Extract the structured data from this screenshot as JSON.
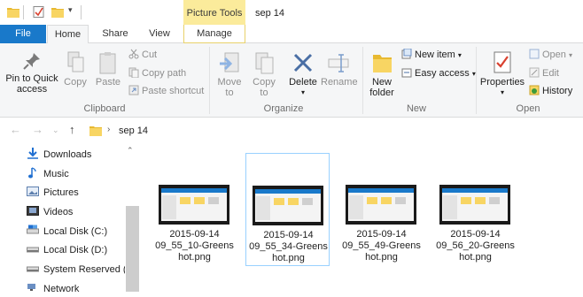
{
  "window": {
    "title": "sep 14",
    "contextual_tab_group": "Picture Tools",
    "qat_icons": [
      "folder-icon",
      "properties-check-icon",
      "new-folder-icon",
      "customize-qat-icon"
    ]
  },
  "tabs": {
    "file": "File",
    "home": "Home",
    "share": "Share",
    "view": "View",
    "manage": "Manage"
  },
  "ribbon": {
    "clipboard": {
      "group_label": "Clipboard",
      "pin_label_1": "Pin to Quick",
      "pin_label_2": "access",
      "copy": "Copy",
      "paste": "Paste",
      "cut": "Cut",
      "copy_path": "Copy path",
      "paste_shortcut": "Paste shortcut"
    },
    "organize": {
      "group_label": "Organize",
      "move_to_1": "Move",
      "move_to_2": "to",
      "copy_to_1": "Copy",
      "copy_to_2": "to",
      "delete": "Delete",
      "rename": "Rename"
    },
    "new": {
      "group_label": "New",
      "new_folder_1": "New",
      "new_folder_2": "folder",
      "new_item": "New item",
      "easy_access": "Easy access"
    },
    "open": {
      "group_label": "Open",
      "properties": "Properties",
      "open": "Open",
      "edit": "Edit",
      "history": "History"
    }
  },
  "address": {
    "path": "sep 14"
  },
  "nav": {
    "items": [
      {
        "label": "Downloads",
        "icon": "download-arrow-icon"
      },
      {
        "label": "Music",
        "icon": "music-note-icon"
      },
      {
        "label": "Pictures",
        "icon": "pictures-icon"
      },
      {
        "label": "Videos",
        "icon": "videos-icon"
      },
      {
        "label": "Local Disk (C:)",
        "icon": "drive-icon"
      },
      {
        "label": "Local Disk (D:)",
        "icon": "drive-icon"
      },
      {
        "label": "System Reserved (F:",
        "icon": "drive-icon"
      },
      {
        "label": "Network",
        "icon": "network-icon"
      }
    ]
  },
  "files": [
    {
      "line1": "2015-09-14",
      "line2": "09_55_10-Greens",
      "line3": "hot.png",
      "selected": false
    },
    {
      "line1": "2015-09-14",
      "line2": "09_55_34-Greens",
      "line3": "hot.png",
      "selected": true
    },
    {
      "line1": "2015-09-14",
      "line2": "09_55_49-Greens",
      "line3": "hot.png",
      "selected": false
    },
    {
      "line1": "2015-09-14",
      "line2": "09_56_20-Greens",
      "line3": "hot.png",
      "selected": false
    }
  ],
  "colors": {
    "file_tab": "#1979ca",
    "picture_tools": "#fbeb9b",
    "selection_border": "#99d1ff"
  }
}
